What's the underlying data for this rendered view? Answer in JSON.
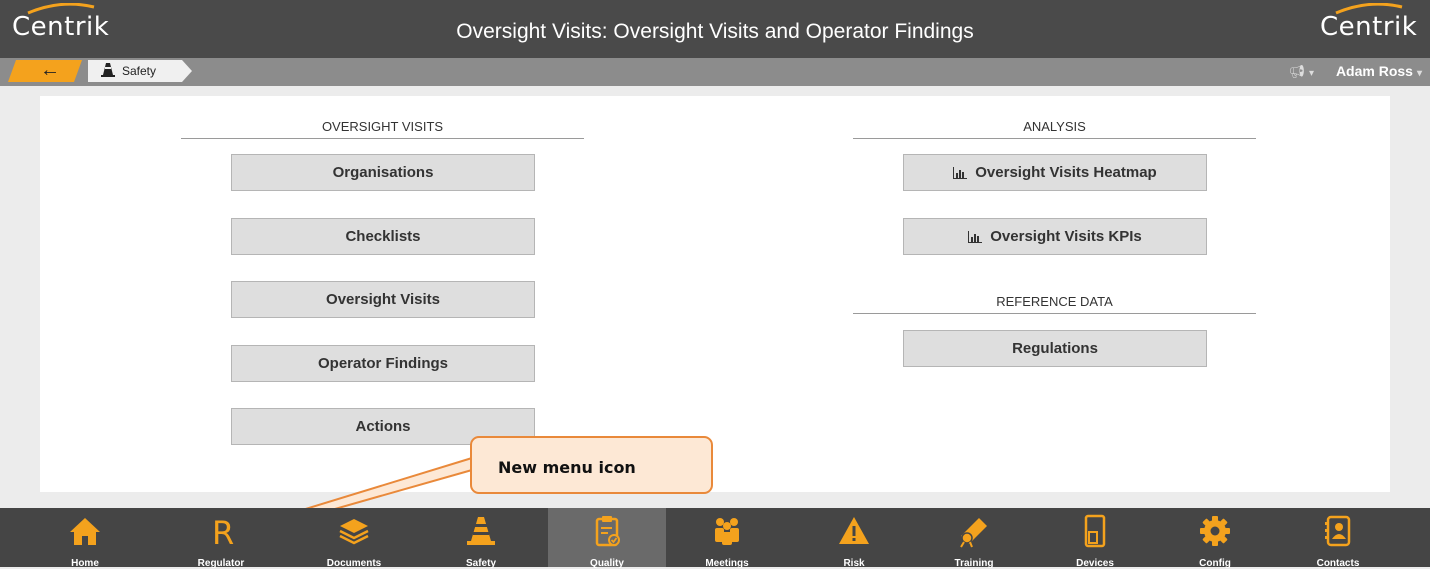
{
  "header": {
    "logo_left": "Centrik",
    "logo_right": "Centrik",
    "title": "Oversight Visits: Oversight Visits and Operator Findings"
  },
  "breadcrumb": {
    "back_icon": "arrow-left-icon",
    "current": "Safety",
    "current_icon": "safety-cone-icon"
  },
  "user_menu": {
    "notify_icon": "megaphone-icon",
    "name": "Adam Ross"
  },
  "sections": {
    "oversight_visits": {
      "heading": "OVERSIGHT VISITS",
      "buttons": [
        "Organisations",
        "Checklists",
        "Oversight Visits",
        "Operator Findings",
        "Actions"
      ]
    },
    "analysis": {
      "heading": "ANALYSIS",
      "buttons": [
        "Oversight Visits Heatmap",
        "Oversight Visits KPIs"
      ]
    },
    "reference_data": {
      "heading": "REFERENCE DATA",
      "buttons": [
        "Regulations"
      ]
    }
  },
  "callout": {
    "text": "New menu icon"
  },
  "bottom_nav": {
    "active": "Quality",
    "items": [
      {
        "label": "Home",
        "icon": "home-icon"
      },
      {
        "label": "Regulator",
        "icon": "letter-r-icon"
      },
      {
        "label": "Documents",
        "icon": "layers-icon"
      },
      {
        "label": "Safety",
        "icon": "safety-cone-icon"
      },
      {
        "label": "Quality",
        "icon": "clipboard-check-icon"
      },
      {
        "label": "Meetings",
        "icon": "people-icon"
      },
      {
        "label": "Risk",
        "icon": "warning-icon"
      },
      {
        "label": "Training",
        "icon": "diploma-icon"
      },
      {
        "label": "Devices",
        "icon": "tablet-icon"
      },
      {
        "label": "Config",
        "icon": "gear-icon"
      },
      {
        "label": "Contacts",
        "icon": "contact-book-icon"
      }
    ]
  },
  "colors": {
    "accent": "#f4a21d",
    "header_bg": "#4a4a4a",
    "nav_bg": "#454545",
    "callout_border": "#e9893a"
  }
}
